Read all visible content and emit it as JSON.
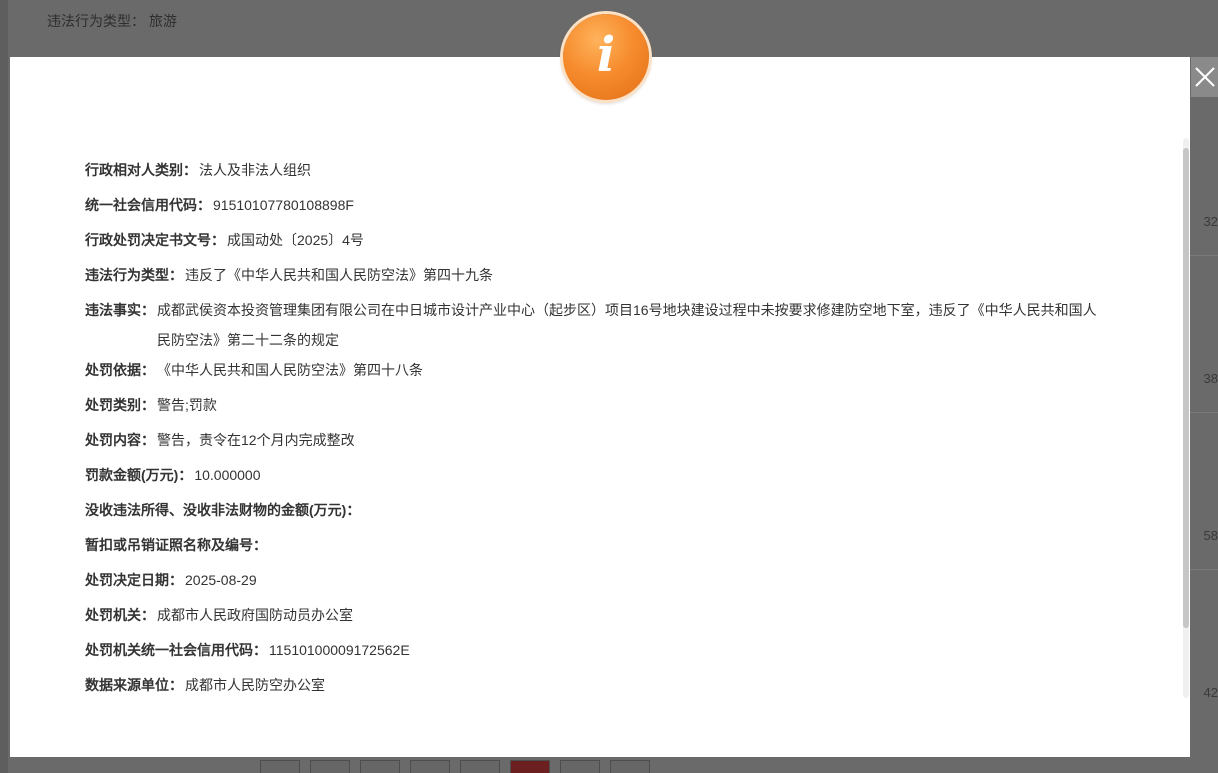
{
  "background": {
    "top_line": "违法行为类型： 旅游",
    "right_numbers": [
      "32",
      "38",
      "58",
      "42"
    ]
  },
  "modal": {
    "icon": "info-icon",
    "close_icon": "close-icon",
    "fields": [
      {
        "label": "行政相对人类别：",
        "value": "法人及非法人组织"
      },
      {
        "label": "统一社会信用代码：",
        "value": "91510107780108898F"
      },
      {
        "label": "行政处罚决定书文号：",
        "value": "成国动处〔2025〕4号"
      },
      {
        "label": "违法行为类型：",
        "value": "违反了《中华人民共和国人民防空法》第四十九条"
      },
      {
        "label": "违法事实：",
        "value": "成都武侯资本投资管理集团有限公司在中日城市设计产业中心（起步区）项目16号地块建设过程中未按要求修建防空地下室，违反了《中华人民共和国人民防空法》第二十二条的规定"
      },
      {
        "label": "处罚依据：",
        "value": "《中华人民共和国人民防空法》第四十八条"
      },
      {
        "label": "处罚类别：",
        "value": "警告;罚款"
      },
      {
        "label": "处罚内容：",
        "value": "警告，责令在12个月内完成整改"
      },
      {
        "label": "罚款金额(万元)：",
        "value": "10.000000"
      },
      {
        "label": "没收违法所得、没收非法财物的金额(万元)：",
        "value": ""
      },
      {
        "label": "暂扣或吊销证照名称及编号：",
        "value": ""
      },
      {
        "label": "处罚决定日期：",
        "value": "2025-08-29"
      },
      {
        "label": "处罚机关：",
        "value": "成都市人民政府国防动员办公室"
      },
      {
        "label": "处罚机关统一社会信用代码：",
        "value": "11510100009172562E"
      },
      {
        "label": "数据来源单位：",
        "value": "成都市人民防空办公室"
      }
    ]
  }
}
